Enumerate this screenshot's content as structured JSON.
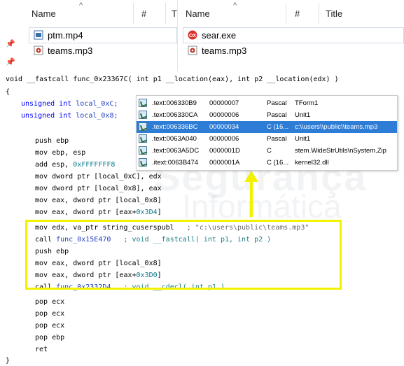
{
  "explorer": {
    "left_pane": {
      "columns": [
        "Name",
        "#",
        "T"
      ],
      "files": [
        {
          "name": "ptm.mp4",
          "icon": "video-file-icon",
          "selected": true
        },
        {
          "name": "teams.mp3",
          "icon": "audio-file-icon",
          "selected": false
        }
      ]
    },
    "right_pane": {
      "columns": [
        "Name",
        "#",
        "Title"
      ],
      "files": [
        {
          "name": "sear.exe",
          "icon": "exe-file-icon",
          "selected": true
        },
        {
          "name": "teams.mp3",
          "icon": "audio-file-icon",
          "selected": false
        }
      ]
    }
  },
  "code": {
    "signature": "void __fastcall func_0x23367C( int p1 __location(eax), int p2 __location(edx) )",
    "open_brace": "{",
    "decl1_type": "unsigned int",
    "decl1_name": "local_0xC;",
    "decl2_type": "unsigned int",
    "decl2_name": "local_0x8;",
    "instructions": [
      {
        "op": "push",
        "args": "ebp"
      },
      {
        "op": "mov",
        "args": "ebp, esp"
      },
      {
        "op": "add",
        "args": "esp, ",
        "imm": "0xFFFFFFF8"
      },
      {
        "op": "mov",
        "args": "dword ptr [local_0xC], edx"
      },
      {
        "op": "mov",
        "args": "dword ptr [local_0x8], eax"
      },
      {
        "op": "mov",
        "args": "eax, dword ptr [local_0x8]"
      },
      {
        "op": "mov",
        "args": "eax, dword ptr [eax+",
        "imm": "0x3D4",
        "tail": "]"
      },
      {
        "op": "mov",
        "args": "edx, va_ptr string_cuserspubl",
        "comment": "; \"c:\\users\\public\\teams.mp3\""
      },
      {
        "op": "call",
        "args": "func_0x15E470",
        "comment": "; void __fastcall( int p1, int p2 )"
      },
      {
        "op": "push",
        "args": "ebp"
      },
      {
        "op": "mov",
        "args": "eax, dword ptr [local_0x8]"
      },
      {
        "op": "mov",
        "args": "eax, dword ptr [eax+",
        "imm": "0x3D0",
        "tail": "]"
      },
      {
        "op": "call",
        "args": "func_0x2332D4",
        "comment": "; void __cdecl( int p1 )"
      },
      {
        "op": "pop",
        "args": "ecx"
      },
      {
        "op": "pop",
        "args": "ecx"
      },
      {
        "op": "pop",
        "args": "ecx"
      },
      {
        "op": "pop",
        "args": "ebp"
      },
      {
        "op": "ret",
        "args": ""
      }
    ],
    "close_brace": "}"
  },
  "strings_popup": {
    "rows": [
      {
        "address": ".text:006330B9",
        "length": "00000007",
        "type": "Pascal",
        "value": "TForm1",
        "selected": false
      },
      {
        "address": ".text:006330CA",
        "length": "00000006",
        "type": "Pascal",
        "value": "Unit1",
        "selected": false
      },
      {
        "address": ".text:006336BC",
        "length": "00000034",
        "type": "C (16...",
        "value": "c:\\\\users\\\\public\\\\teams.mp3",
        "selected": true
      },
      {
        "address": ".text:0063A040",
        "length": "00000006",
        "type": "Pascal",
        "value": "Unit1",
        "selected": false
      },
      {
        "address": ".text:0063A5DC",
        "length": "0000001D",
        "type": "C",
        "value": "stem.WideStrUtils\\nSystem.Zip",
        "selected": false
      },
      {
        "address": ".itext:0063B474",
        "length": "0000001A",
        "type": "C (16...",
        "value": "kernel32.dll",
        "selected": false
      }
    ]
  },
  "watermark": {
    "line1": "Segurança",
    "line2": "Informática"
  },
  "colors": {
    "highlight": "#f2f200",
    "selection": "#2d7cd6",
    "keyword": "#0000ff"
  }
}
